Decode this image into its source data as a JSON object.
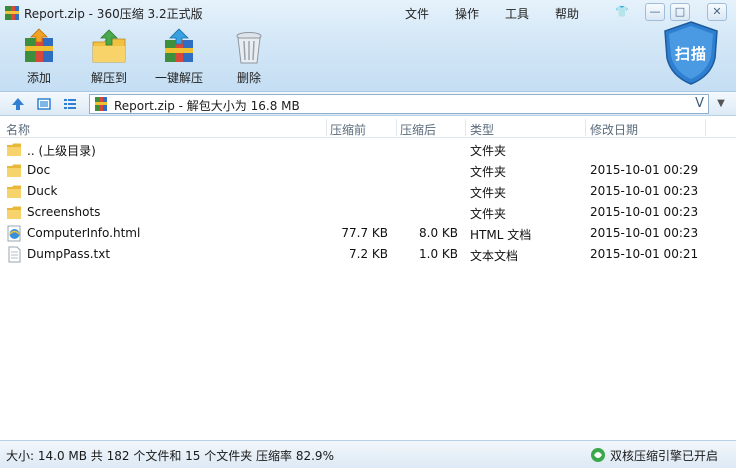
{
  "window": {
    "title": "Report.zip - 360压缩 3.2正式版",
    "menu": [
      "文件",
      "操作",
      "工具",
      "帮助"
    ],
    "controls": {
      "skin": "👕",
      "minimize": "—",
      "maximize": "□",
      "close": "✕"
    }
  },
  "toolbar": {
    "add": "添加",
    "extract_to": "解压到",
    "one_click_extract": "一键解压",
    "delete": "删除",
    "scan": "扫描"
  },
  "address": {
    "text": "Report.zip - 解包大小为 16.8 MB",
    "v_glyph": "V",
    "dropdown": "▼"
  },
  "columns": [
    "名称",
    "压缩前",
    "压缩后",
    "类型",
    "修改日期"
  ],
  "rows": [
    {
      "icon": "folder-icon",
      "name": ".. (上级目录)",
      "original": "",
      "compressed": "",
      "type": "文件夹",
      "modified": ""
    },
    {
      "icon": "folder-icon",
      "name": "Doc",
      "original": "",
      "compressed": "",
      "type": "文件夹",
      "modified": "2015-10-01 00:29"
    },
    {
      "icon": "folder-icon",
      "name": "Duck",
      "original": "",
      "compressed": "",
      "type": "文件夹",
      "modified": "2015-10-01 00:23"
    },
    {
      "icon": "folder-icon",
      "name": "Screenshots",
      "original": "",
      "compressed": "",
      "type": "文件夹",
      "modified": "2015-10-01 00:23"
    },
    {
      "icon": "html-file-icon",
      "name": "ComputerInfo.html",
      "original": "77.7 KB",
      "compressed": "8.0 KB",
      "type": "HTML 文档",
      "modified": "2015-10-01 00:23"
    },
    {
      "icon": "text-file-icon",
      "name": "DumpPass.txt",
      "original": "7.2 KB",
      "compressed": "1.0 KB",
      "type": "文本文档",
      "modified": "2015-10-01 00:21"
    }
  ],
  "status": {
    "summary": "大小: 14.0 MB 共 182 个文件和 15 个文件夹 压缩率 82.9%",
    "dual_core": "双核压缩引擎已开启"
  },
  "colors": {
    "accent": "#2f7fd0",
    "toolbar_bg": "#d3e7f7",
    "folder": "#e8b83a"
  }
}
